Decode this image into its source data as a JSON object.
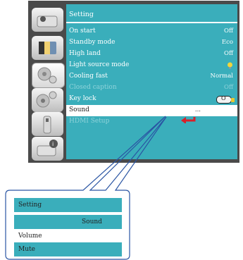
{
  "menu": {
    "title": "Setting",
    "items": [
      {
        "label": "On start",
        "value": "Off"
      },
      {
        "label": "Standby mode",
        "value": "Eco"
      },
      {
        "label": "High land",
        "value": "Off"
      },
      {
        "label": "Light source mode",
        "value": "",
        "icon": "bulb-icon"
      },
      {
        "label": "Cooling fast",
        "value": "Normal"
      },
      {
        "label": "Closed caption",
        "value": "Off",
        "disabled": true
      },
      {
        "label": "Key lock",
        "value": "O",
        "icon": "key-lock-toggle"
      },
      {
        "label": "Sound",
        "value": "...",
        "selected": true
      },
      {
        "label": "HDMI Setup",
        "value": "",
        "disabled": true
      }
    ]
  },
  "tabs": [
    "picture-icon",
    "image-adjust-icon",
    "setting-icon",
    "expanded-setting-icon",
    "memory-icon",
    "info-icon"
  ],
  "submenu": {
    "title": "Setting",
    "header": "Sound",
    "items": [
      "Volume",
      "Mute"
    ]
  },
  "colors": {
    "panel": "#3aaebb",
    "frame": "#4a4a4a",
    "highlight": "#ffffff",
    "arrow": "#d8202a",
    "callout": "#2a55a3"
  }
}
